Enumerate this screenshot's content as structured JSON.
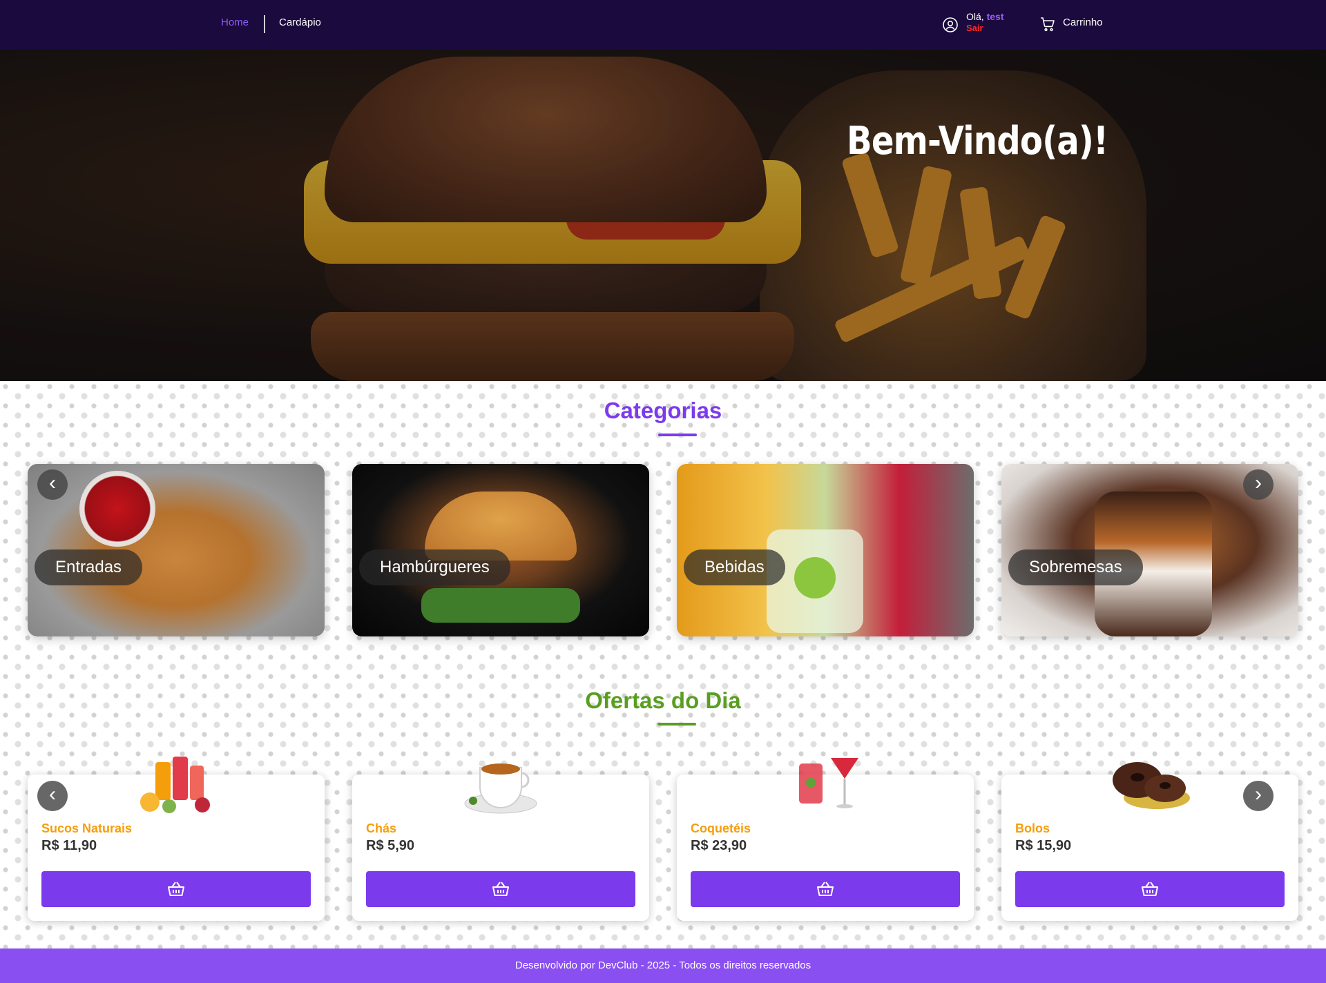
{
  "nav": {
    "home": "Home",
    "menu": "Cardápio",
    "greeting": "Olá,",
    "username": "test",
    "logout": "Sair",
    "cart": "Carrinho"
  },
  "hero": {
    "title": "Bem-Vindo(a)!"
  },
  "categories": {
    "title": "Categorias",
    "items": [
      {
        "label": "Entradas"
      },
      {
        "label": "Hambúrgueres"
      },
      {
        "label": "Bebidas"
      },
      {
        "label": "Sobremesas"
      }
    ]
  },
  "offers": {
    "title": "Ofertas do Dia",
    "items": [
      {
        "name": "Sucos Naturais",
        "price": "R$ 11,90"
      },
      {
        "name": "Chás",
        "price": "R$ 5,90"
      },
      {
        "name": "Coquetéis",
        "price": "R$ 23,90"
      },
      {
        "name": "Bolos",
        "price": "R$ 15,90"
      }
    ]
  },
  "footer": {
    "text": "Desenvolvido por DevClub - 2025 - Todos os direitos reservados"
  },
  "icons": {
    "user": "user-circle-icon",
    "cart": "shopping-cart-icon",
    "add": "basket-icon",
    "prev": "chevron-left-icon",
    "next": "chevron-right-icon"
  },
  "colors": {
    "header_bg": "#1b0a3d",
    "accent": "#7c3aed",
    "offers_title": "#5a9e21",
    "offer_name": "#f59e0b",
    "logout": "#ff2a2a",
    "footer_bg": "#8a4ff0"
  }
}
